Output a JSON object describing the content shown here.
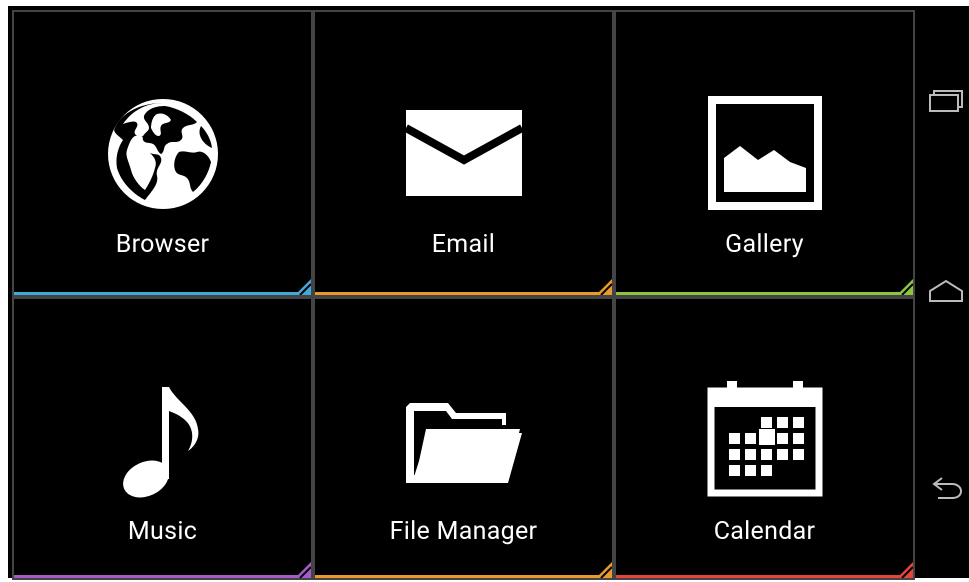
{
  "tiles": [
    {
      "label": "Browser",
      "accent": "#3fa9d8",
      "icon": "globe-icon"
    },
    {
      "label": "Email",
      "accent": "#e89a2a",
      "icon": "envelope-icon"
    },
    {
      "label": "Gallery",
      "accent": "#8cc63f",
      "icon": "picture-icon"
    },
    {
      "label": "Music",
      "accent": "#a45bc8",
      "icon": "music-note-icon"
    },
    {
      "label": "File Manager",
      "accent": "#e89a2a",
      "icon": "folder-icon"
    },
    {
      "label": "Calendar",
      "accent": "#e5443a",
      "icon": "calendar-icon"
    }
  ],
  "nav": {
    "buttons": [
      "recent-apps-icon",
      "home-icon",
      "back-icon"
    ]
  },
  "colors": {
    "background": "#000000",
    "tile_border": "#444444",
    "text": "#ffffff"
  }
}
